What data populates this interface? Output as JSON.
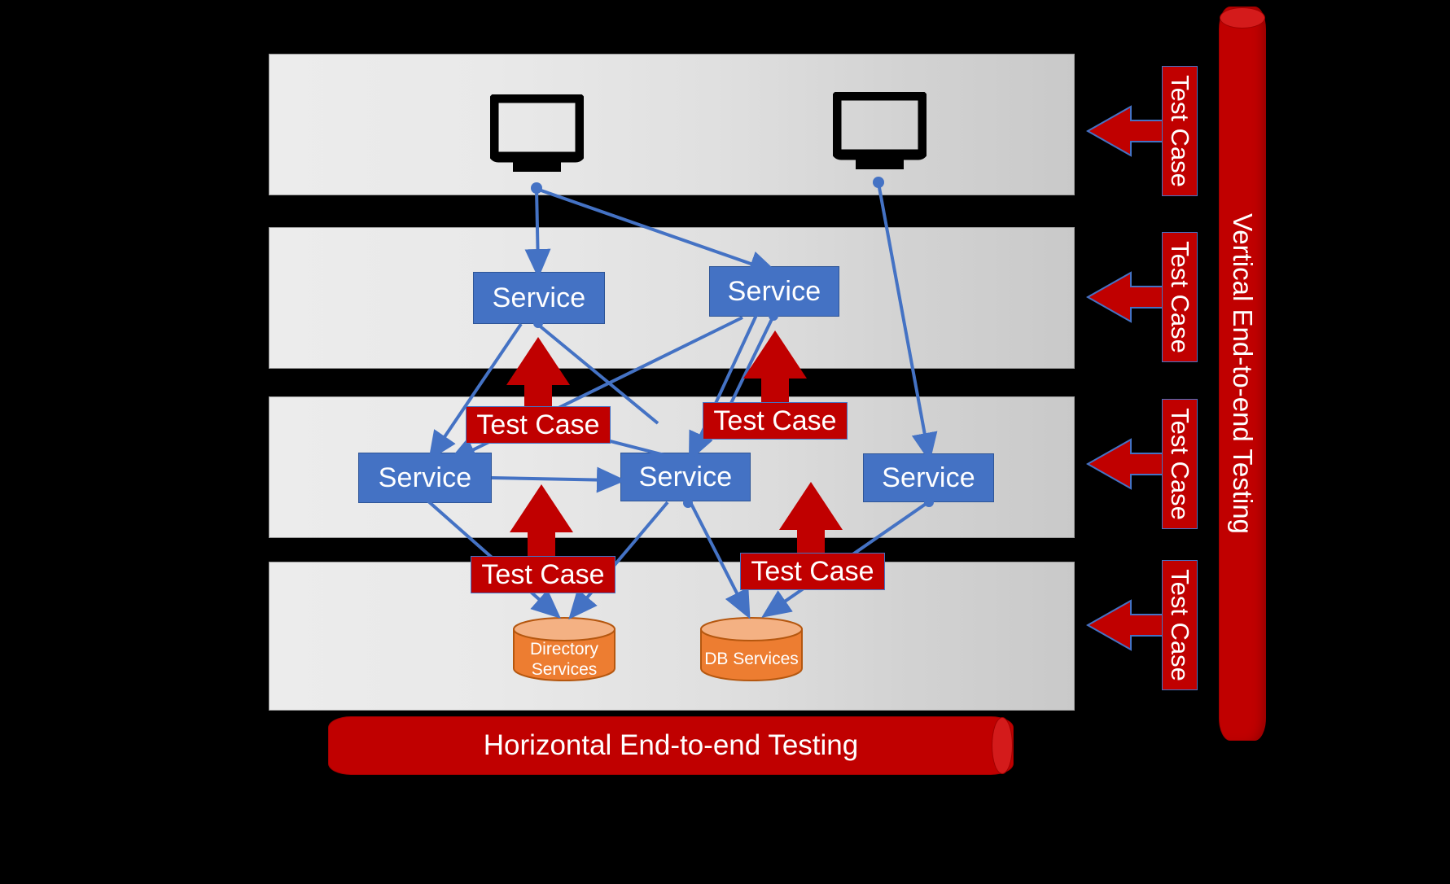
{
  "diagram": {
    "title": "End-to-end Testing Layered Architecture Diagram",
    "colors": {
      "background": "#000000",
      "band": "#e4e4e4",
      "service": "#4472C4",
      "test_case": "#C00000",
      "datastore": "#ED7D31",
      "connector": "#4472C4"
    },
    "bands": [
      {
        "name": "presentation-layer"
      },
      {
        "name": "service-layer-upper"
      },
      {
        "name": "service-layer-lower"
      },
      {
        "name": "data-layer"
      }
    ],
    "clients": [
      {
        "label": "",
        "icon": "monitor-icon"
      },
      {
        "label": "",
        "icon": "monitor-icon"
      }
    ],
    "services": [
      {
        "label": "Service"
      },
      {
        "label": "Service"
      },
      {
        "label": "Service"
      },
      {
        "label": "Service"
      },
      {
        "label": "Service"
      }
    ],
    "test_cases": [
      {
        "label": "Test Case"
      },
      {
        "label": "Test Case"
      },
      {
        "label": "Test Case"
      },
      {
        "label": "Test Case"
      }
    ],
    "datastores": [
      {
        "line1": "Directory",
        "line2": "Services"
      },
      {
        "line1": "DB Services",
        "line2": ""
      }
    ],
    "vertical_test_cases": [
      {
        "label": "Test Case"
      },
      {
        "label": "Test Case"
      },
      {
        "label": "Test Case"
      },
      {
        "label": "Test Case"
      }
    ],
    "vertical_bar": {
      "label": "Vertical End-to-end Testing"
    },
    "horizontal_bar": {
      "label": "Horizontal End-to-end Testing"
    }
  }
}
